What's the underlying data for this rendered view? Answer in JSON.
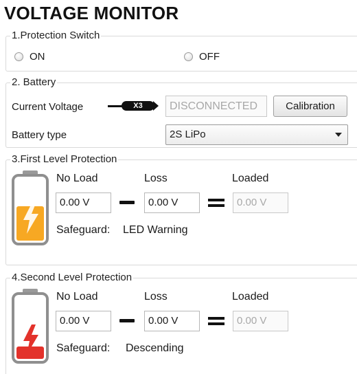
{
  "app": {
    "title": "VOLTAGE MONITOR"
  },
  "protection_switch": {
    "legend": "1.Protection Switch",
    "options": [
      {
        "label": "ON",
        "selected": false
      },
      {
        "label": "OFF",
        "selected": false
      }
    ]
  },
  "battery": {
    "legend": "2. Battery",
    "current_voltage_label": "Current Voltage",
    "connector_label": "X3",
    "current_voltage_value": "DISCONNECTED",
    "calibration_button": "Calibration",
    "battery_type_label": "Battery type",
    "battery_type_selected": "2S LiPo"
  },
  "first_level": {
    "legend": "3.First Level Protection",
    "battery_icon_level": 0.55,
    "battery_icon_color": "#f7a823",
    "headers": {
      "no_load": "No Load",
      "loss": "Loss",
      "loaded": "Loaded"
    },
    "values": {
      "no_load": "0.00 V",
      "loss": "0.00 V",
      "loaded": "0.00 V"
    },
    "safeguard_label": "Safeguard:",
    "safeguard_value": "LED Warning"
  },
  "second_level": {
    "legend": "4.Second Level Protection",
    "battery_icon_level": 0.2,
    "battery_icon_color": "#e3322b",
    "headers": {
      "no_load": "No Load",
      "loss": "Loss",
      "loaded": "Loaded"
    },
    "values": {
      "no_load": "0.00 V",
      "loss": "0.00 V",
      "loaded": "0.00 V"
    },
    "safeguard_label": "Safeguard:",
    "safeguard_value": "Descending"
  }
}
